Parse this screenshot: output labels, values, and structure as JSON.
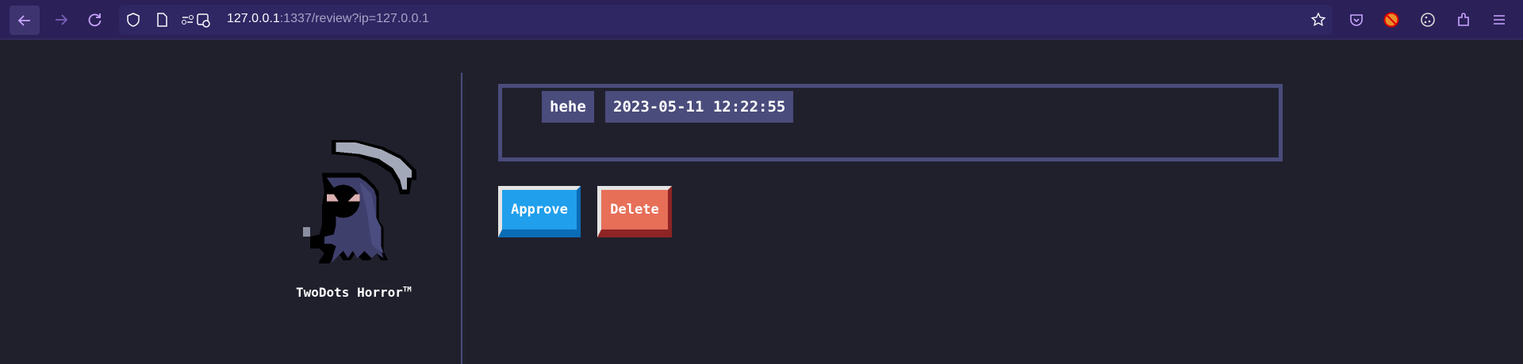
{
  "browser": {
    "url_host": "127.0.0.1",
    "url_rest": ":1337/review?ip=127.0.0.1",
    "icons": [
      "back-icon",
      "forward-icon",
      "reload-icon",
      "shield-icon",
      "page-icon",
      "permissions-icon",
      "star-icon",
      "pocket-icon",
      "extension-icon",
      "cookie-icon",
      "puzzle-icon",
      "menu-icon"
    ]
  },
  "sidebar": {
    "brand": "TwoDots Horror",
    "trademark": "TM"
  },
  "review": {
    "author": "hehe",
    "timestamp": "2023-05-11 12:22:55"
  },
  "actions": {
    "approve": "Approve",
    "delete": "Delete"
  },
  "colors": {
    "approve": "#209fec",
    "delete": "#e76f58",
    "border": "#4a4c7c"
  }
}
